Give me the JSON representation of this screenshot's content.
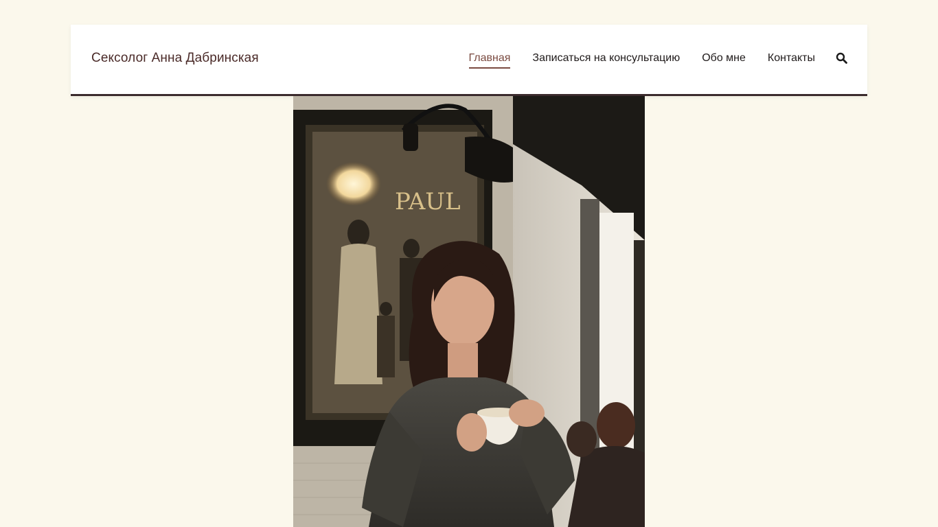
{
  "header": {
    "site_title": "Сексолог Анна Дабринская",
    "nav": [
      {
        "label": "Главная",
        "active": true
      },
      {
        "label": "Записаться на консультацию",
        "active": false
      },
      {
        "label": "Обо мне",
        "active": false
      },
      {
        "label": "Контакты",
        "active": false
      }
    ],
    "search_icon": "search-icon"
  },
  "hero": {
    "photo_sign_text": "PAUL"
  },
  "colors": {
    "background": "#fbf8ec",
    "header_border": "#3a2a2c",
    "title": "#4a2a28",
    "active_nav": "#7a4a40"
  }
}
